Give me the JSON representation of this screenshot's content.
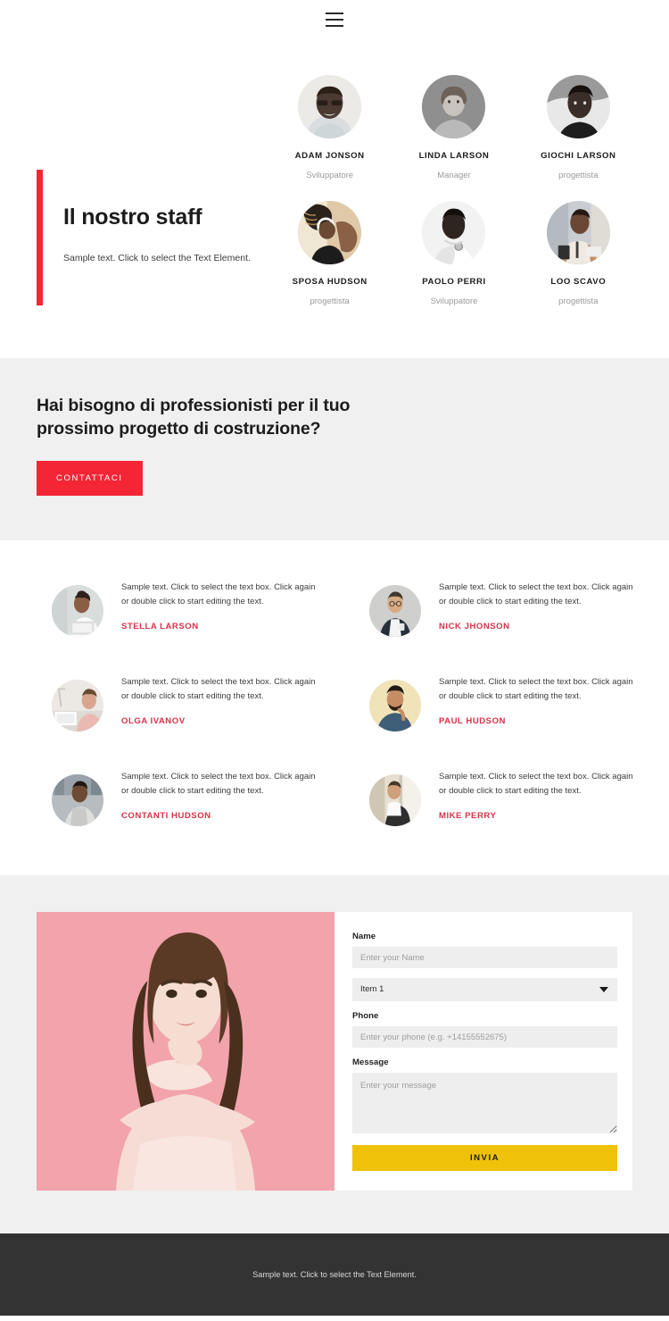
{
  "header": {
    "menu_icon": "hamburger-menu-icon"
  },
  "staff": {
    "title": "Il nostro staff",
    "subtitle": "Sample text. Click to select the Text Element.",
    "members": [
      {
        "name": "ADAM JONSON",
        "role": "Sviluppatore"
      },
      {
        "name": "LINDA LARSON",
        "role": "Manager"
      },
      {
        "name": "GIOCHI LARSON",
        "role": "progettista"
      },
      {
        "name": "SPOSA HUDSON",
        "role": "progettista"
      },
      {
        "name": "PAOLO PERRI",
        "role": "Sviluppatore"
      },
      {
        "name": "LOO SCAVO",
        "role": "progettista"
      }
    ]
  },
  "cta": {
    "title": "Hai bisogno di professionisti per il tuo prossimo progetto di costruzione?",
    "button_label": "CONTATTACI",
    "button_color": "#f42534"
  },
  "testimonials": [
    {
      "text": "Sample text. Click to select the text box. Click again or double click to start editing the text.",
      "name": "STELLA LARSON"
    },
    {
      "text": "Sample text. Click to select the text box. Click again or double click to start editing the text.",
      "name": "NICK JHONSON"
    },
    {
      "text": "Sample text. Click to select the text box. Click again or double click to start editing the text.",
      "name": "OLGA IVANOV"
    },
    {
      "text": "Sample text. Click to select the text box. Click again or double click to start editing the text.",
      "name": "PAUL HUDSON"
    },
    {
      "text": "Sample text. Click to select the text box. Click again or double click to start editing the text.",
      "name": "CONTANTI HUDSON"
    },
    {
      "text": "Sample text. Click to select the text box. Click again or double click to start editing the text.",
      "name": "MIKE PERRY"
    }
  ],
  "contact": {
    "name_label": "Name",
    "name_placeholder": "Enter your Name",
    "select_value": "Item 1",
    "select_options": [
      "Item 1"
    ],
    "phone_label": "Phone",
    "phone_placeholder": "Enter your phone (e.g. +14155552675)",
    "message_label": "Message",
    "message_placeholder": "Enter your message",
    "submit_label": "INVIA",
    "submit_color": "#efc109"
  },
  "footer": {
    "text": "Sample text. Click to select the Text Element."
  }
}
